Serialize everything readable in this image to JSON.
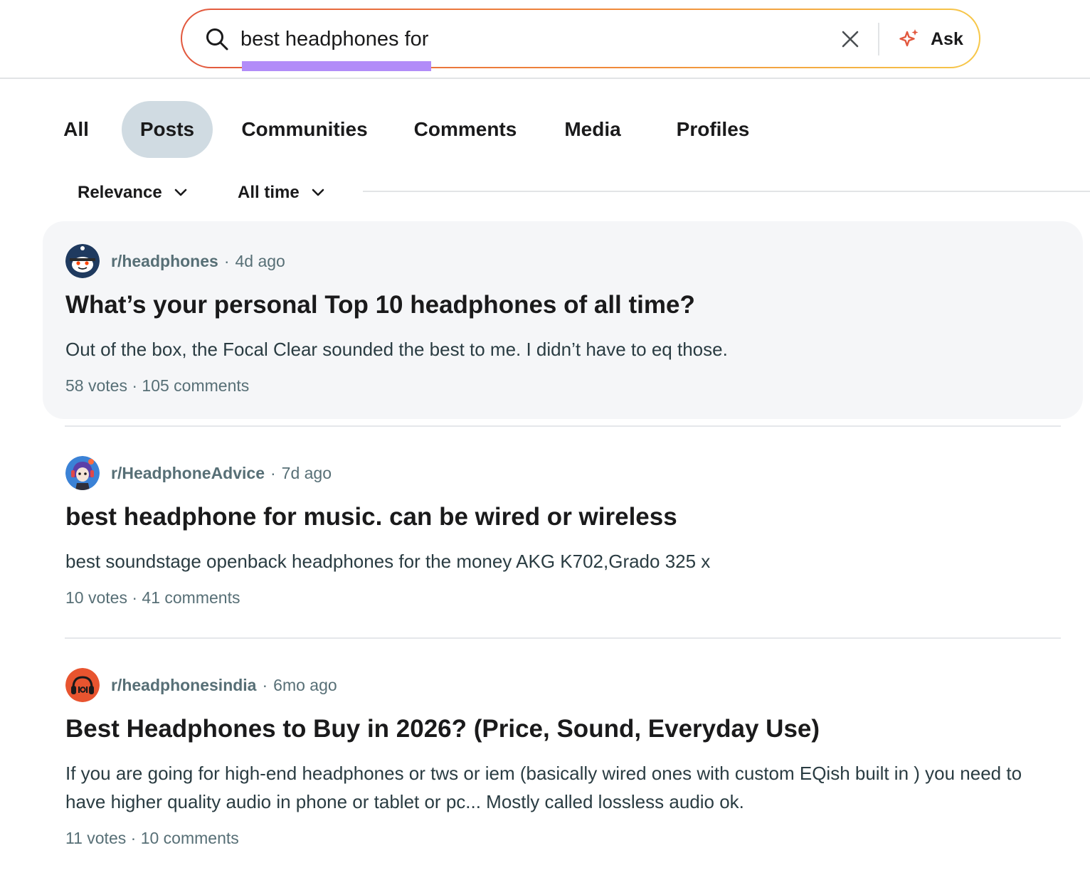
{
  "search": {
    "query": "best headphones for",
    "ask_label": "Ask"
  },
  "tabs": [
    {
      "label": "All",
      "active": false
    },
    {
      "label": "Posts",
      "active": true
    },
    {
      "label": "Communities",
      "active": false
    },
    {
      "label": "Comments",
      "active": false
    },
    {
      "label": "Media",
      "active": false
    },
    {
      "label": "Profiles",
      "active": false
    }
  ],
  "sort": {
    "relevance_label": "Relevance",
    "time_label": "All time"
  },
  "posts": [
    {
      "subreddit": "r/headphones",
      "age": "4d ago",
      "title": "What’s your personal Top 10 headphones of all time?",
      "body": "Out of the box, the Focal Clear sounded the best to me. I didn’t have to eq those.",
      "votes": "58 votes",
      "comments": "105 comments",
      "avatar_icon": "snoo-icon"
    },
    {
      "subreddit": "r/HeadphoneAdvice",
      "age": "7d ago",
      "title": "best headphone for music. can be wired or wireless",
      "body": "best soundstage openback headphones for the money AKG K702,Grado 325 x",
      "votes": "10 votes",
      "comments": "41 comments",
      "avatar_icon": "anime-character-icon"
    },
    {
      "subreddit": "r/headphonesindia",
      "age": "6mo ago",
      "title": "Best Headphones to Buy in 2026? (Price, Sound, Everyday Use)",
      "body": "If you are going for high-end headphones or tws or iem (basically wired ones with custom EQish built in ) you need to have higher quality audio in phone or tablet or pc... Mostly called lossless audio ok.",
      "votes": "11 votes",
      "comments": "10 comments",
      "avatar_icon": "headphones-icon"
    }
  ],
  "colors": {
    "accent_gradient_start": "#e2583e",
    "accent_gradient_end": "#f7c84a",
    "active_tab_bg": "#d0dbe2",
    "highlight_underline": "#b28cf8",
    "meta_text": "#576f76",
    "headphonesindia_avatar": "#e8542f"
  }
}
